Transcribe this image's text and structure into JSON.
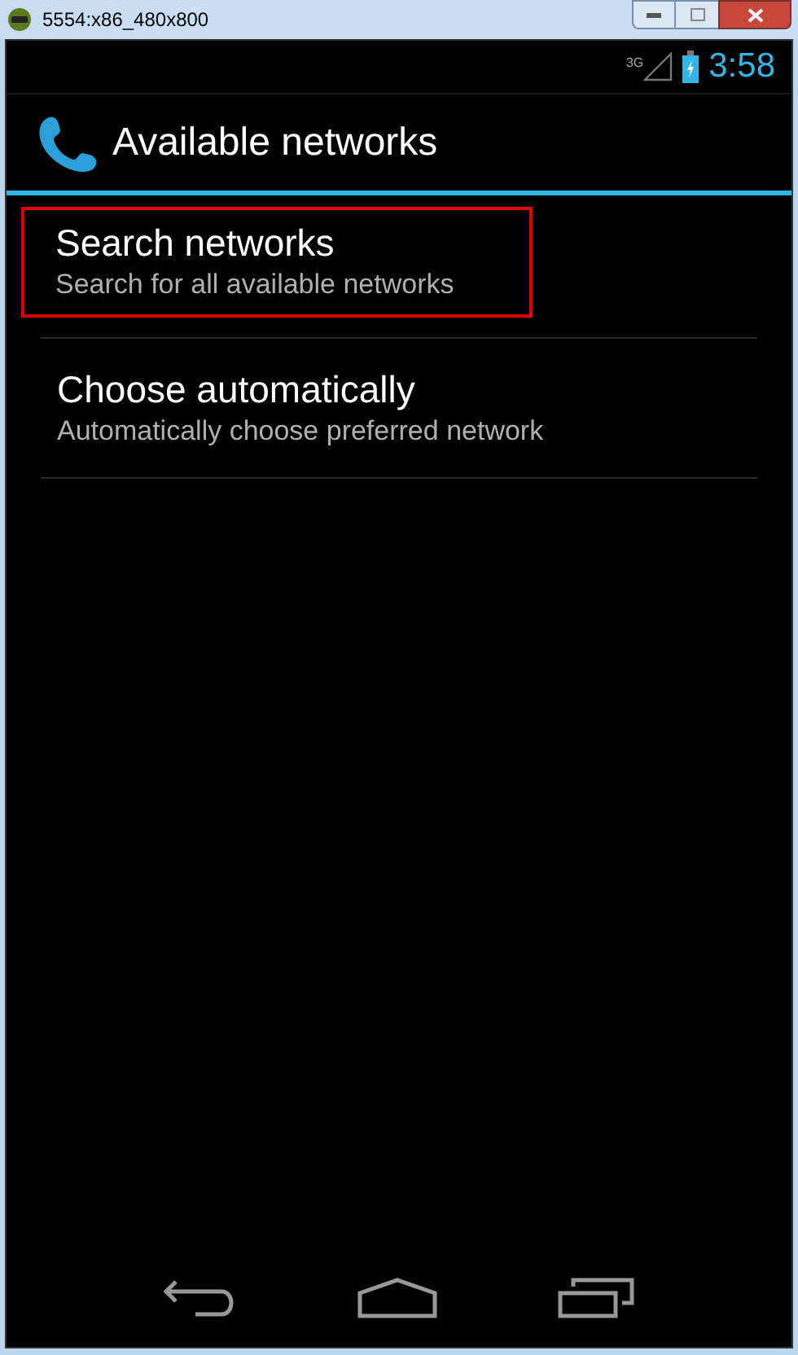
{
  "window": {
    "title": "5554:x86_480x800"
  },
  "status_bar": {
    "network": "3G",
    "time": "3:58"
  },
  "action_bar": {
    "title": "Available networks"
  },
  "items": [
    {
      "title": "Search networks",
      "summary": "Search for all available networks",
      "highlighted": true
    },
    {
      "title": "Choose automatically",
      "summary": "Automatically choose preferred network",
      "highlighted": false
    }
  ]
}
